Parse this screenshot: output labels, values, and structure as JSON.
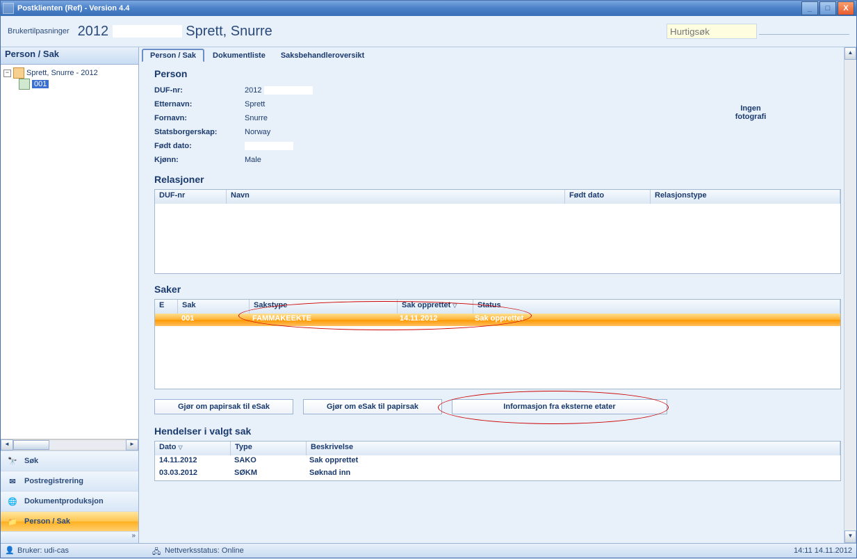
{
  "window": {
    "title": "Postklienten (Ref) - Version 4.4"
  },
  "topstrip": {
    "settings_label": "Brukertilpasninger",
    "big_title_prefix": "2012",
    "big_title_name": "Sprett, Snurre",
    "quicksearch_placeholder": "Hurtigsøk"
  },
  "sidebar": {
    "header": "Person / Sak",
    "tree": {
      "root_label": "Sprett, Snurre - 2012",
      "child_label": "001"
    },
    "nav": [
      {
        "label": "Søk",
        "icon": "binoculars-icon"
      },
      {
        "label": "Postregistrering",
        "icon": "envelope-icon"
      },
      {
        "label": "Dokumentproduksjon",
        "icon": "globe-doc-icon"
      },
      {
        "label": "Person / Sak",
        "icon": "folder-search-icon"
      }
    ]
  },
  "tabs": [
    {
      "label": "Person / Sak",
      "active": true
    },
    {
      "label": "Dokumentliste",
      "active": false
    },
    {
      "label": "Saksbehandleroversikt",
      "active": false
    }
  ],
  "person": {
    "title": "Person",
    "fields": {
      "duf_label": "DUF-nr:",
      "duf_value": "2012",
      "etternavn_label": "Etternavn:",
      "etternavn_value": "Sprett",
      "fornavn_label": "Fornavn:",
      "fornavn_value": "Snurre",
      "statsborgerskap_label": "Statsborgerskap:",
      "statsborgerskap_value": "Norway",
      "fodt_label": "Født dato:",
      "fodt_value": "",
      "kjonn_label": "Kjønn:",
      "kjonn_value": "Male"
    },
    "photo_line1": "Ingen",
    "photo_line2": "fotografi"
  },
  "relasjoner": {
    "title": "Relasjoner",
    "columns": {
      "duf": "DUF-nr",
      "navn": "Navn",
      "fodt": "Født dato",
      "reltype": "Relasjonstype"
    }
  },
  "saker": {
    "title": "Saker",
    "columns": {
      "e": "E",
      "sak": "Sak",
      "sakstype": "Sakstype",
      "sak_opprettet": "Sak opprettet",
      "status": "Status"
    },
    "rows": [
      {
        "e": "",
        "sak": "001",
        "sakstype": "FAMMAKEEKTE",
        "sak_opprettet": "14.11.2012",
        "status": "Sak opprettet"
      }
    ]
  },
  "buttons": {
    "to_esak": "Gjør om papirsak til eSak",
    "to_papirsak": "Gjør om eSak til papirsak",
    "eksterne": "Informasjon fra eksterne etater"
  },
  "hendelser": {
    "title": "Hendelser i valgt sak",
    "columns": {
      "dato": "Dato",
      "type": "Type",
      "beskrivelse": "Beskrivelse"
    },
    "rows": [
      {
        "dato": "14.11.2012",
        "type": "SAKO",
        "beskrivelse": "Sak opprettet"
      },
      {
        "dato": "03.03.2012",
        "type": "SØKM",
        "beskrivelse": "Søknad inn"
      }
    ]
  },
  "statusbar": {
    "bruker_label": "Bruker: udi-cas",
    "nett_label": "Nettverksstatus: Online",
    "clock": "14:11 14.11.2012"
  }
}
